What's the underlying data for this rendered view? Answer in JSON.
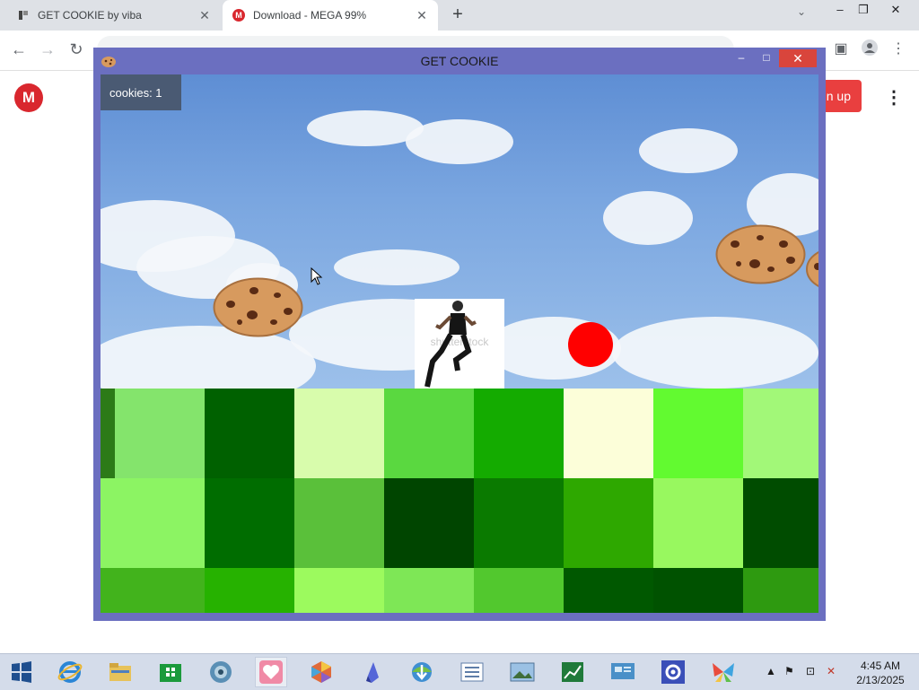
{
  "browser": {
    "tabs": [
      {
        "title": "GET COOKIE by viba",
        "active": false
      },
      {
        "title": "Download - MEGA 99%",
        "active": true
      }
    ],
    "new_tab_icon": "+",
    "window_controls": {
      "minimize": "–",
      "restore": "❐",
      "close": "✕"
    }
  },
  "page": {
    "logo_letter": "M",
    "signup_label": "n up",
    "more_icon": "⋮"
  },
  "game_window": {
    "title": "GET COOKIE",
    "min_symbol": "–",
    "max_symbol": "□",
    "close_symbol": "✕",
    "counter_text": "cookies: 1",
    "player_caption": "shutterstock"
  },
  "taskbar": {
    "time": "4:45 AM",
    "date": "2/13/2025"
  },
  "colors": {
    "game_frame": "#6b6fc0",
    "ball": "#ff0000",
    "close_red": "#d9453c",
    "mega_red": "#d9272e"
  }
}
